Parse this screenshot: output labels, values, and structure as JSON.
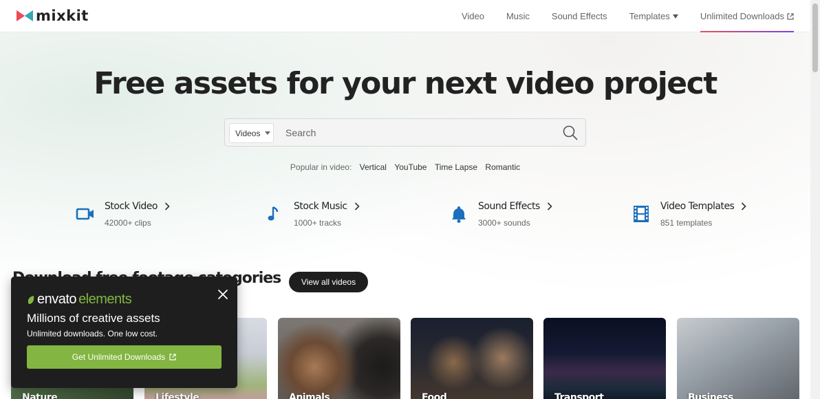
{
  "header": {
    "logo_text": "mixkit",
    "nav": [
      {
        "label": "Video"
      },
      {
        "label": "Music"
      },
      {
        "label": "Sound Effects"
      },
      {
        "label": "Templates",
        "icon": "caret-down-icon"
      },
      {
        "label": "Unlimited Downloads",
        "icon": "external-link-icon",
        "active": true
      }
    ]
  },
  "hero": {
    "title": "Free assets for your next video project",
    "search": {
      "category_selected": "Videos",
      "placeholder": "Search"
    },
    "popular": {
      "label": "Popular in video:",
      "tags": [
        "Vertical",
        "YouTube",
        "Time Lapse",
        "Romantic"
      ]
    }
  },
  "categories": [
    {
      "title": "Stock Video",
      "subtitle": "42000+ clips",
      "icon": "video-camera-icon"
    },
    {
      "title": "Stock Music",
      "subtitle": "1000+ tracks",
      "icon": "music-note-icon"
    },
    {
      "title": "Sound Effects",
      "subtitle": "3000+ sounds",
      "icon": "bell-icon"
    },
    {
      "title": "Video Templates",
      "subtitle": "851 templates",
      "icon": "film-strip-icon"
    }
  ],
  "section": {
    "title": "Download free footage categories",
    "view_all_label": "View all videos"
  },
  "category_cards": [
    "Nature",
    "Lifestyle",
    "Animals",
    "Food",
    "Transport",
    "Business"
  ],
  "popup": {
    "brand_envato": "envato",
    "brand_elements": "elements",
    "headline": "Millions of creative assets",
    "subtext": "Unlimited downloads. One low cost.",
    "button_label": "Get Unlimited Downloads"
  },
  "colors": {
    "accent_blue": "#1b6fbb",
    "envato_green": "#82b541",
    "dark": "#1e1e1e",
    "underline_gradient": [
      "#e8505b",
      "#7b3fe4"
    ]
  }
}
